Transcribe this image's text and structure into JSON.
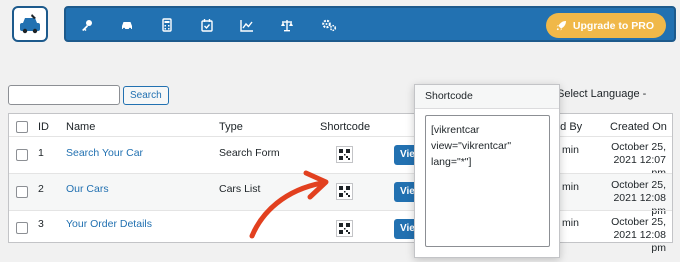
{
  "header": {
    "upgrade_label": "Upgrade to PRO",
    "nav_icons": [
      "key-icon",
      "car-icon",
      "calculator-icon",
      "calendar-check-icon",
      "chart-icon",
      "scale-icon",
      "cogs-icon"
    ],
    "brand_color": "#2271b1",
    "accent_color": "#f0b849"
  },
  "toolbar": {
    "search_label": "Search",
    "search_value": "",
    "language_label": "Select Language -"
  },
  "table": {
    "columns": [
      "ID",
      "Name",
      "Type",
      "Shortcode",
      "Created By",
      "Created On"
    ],
    "rows": [
      {
        "id": "1",
        "name": "Search Your Car",
        "type": "Search Form",
        "view": "View",
        "author": "min",
        "date1": "October 25,",
        "date2": "2021 12:07 pm"
      },
      {
        "id": "2",
        "name": "Our Cars",
        "type": "Cars List",
        "view": "View",
        "author": "min",
        "date1": "October 25,",
        "date2": "2021 12:08 pm"
      },
      {
        "id": "3",
        "name": "Your Order Details",
        "type": "",
        "view": "View",
        "author": "min",
        "date1": "October 25,",
        "date2": "2021 12:08 pm"
      }
    ]
  },
  "popup": {
    "title": "Shortcode",
    "content": "[vikrentcar\nview=\"vikrentcar\"\nlang=\"*\"]"
  },
  "created_by_label_partial": "ted By"
}
